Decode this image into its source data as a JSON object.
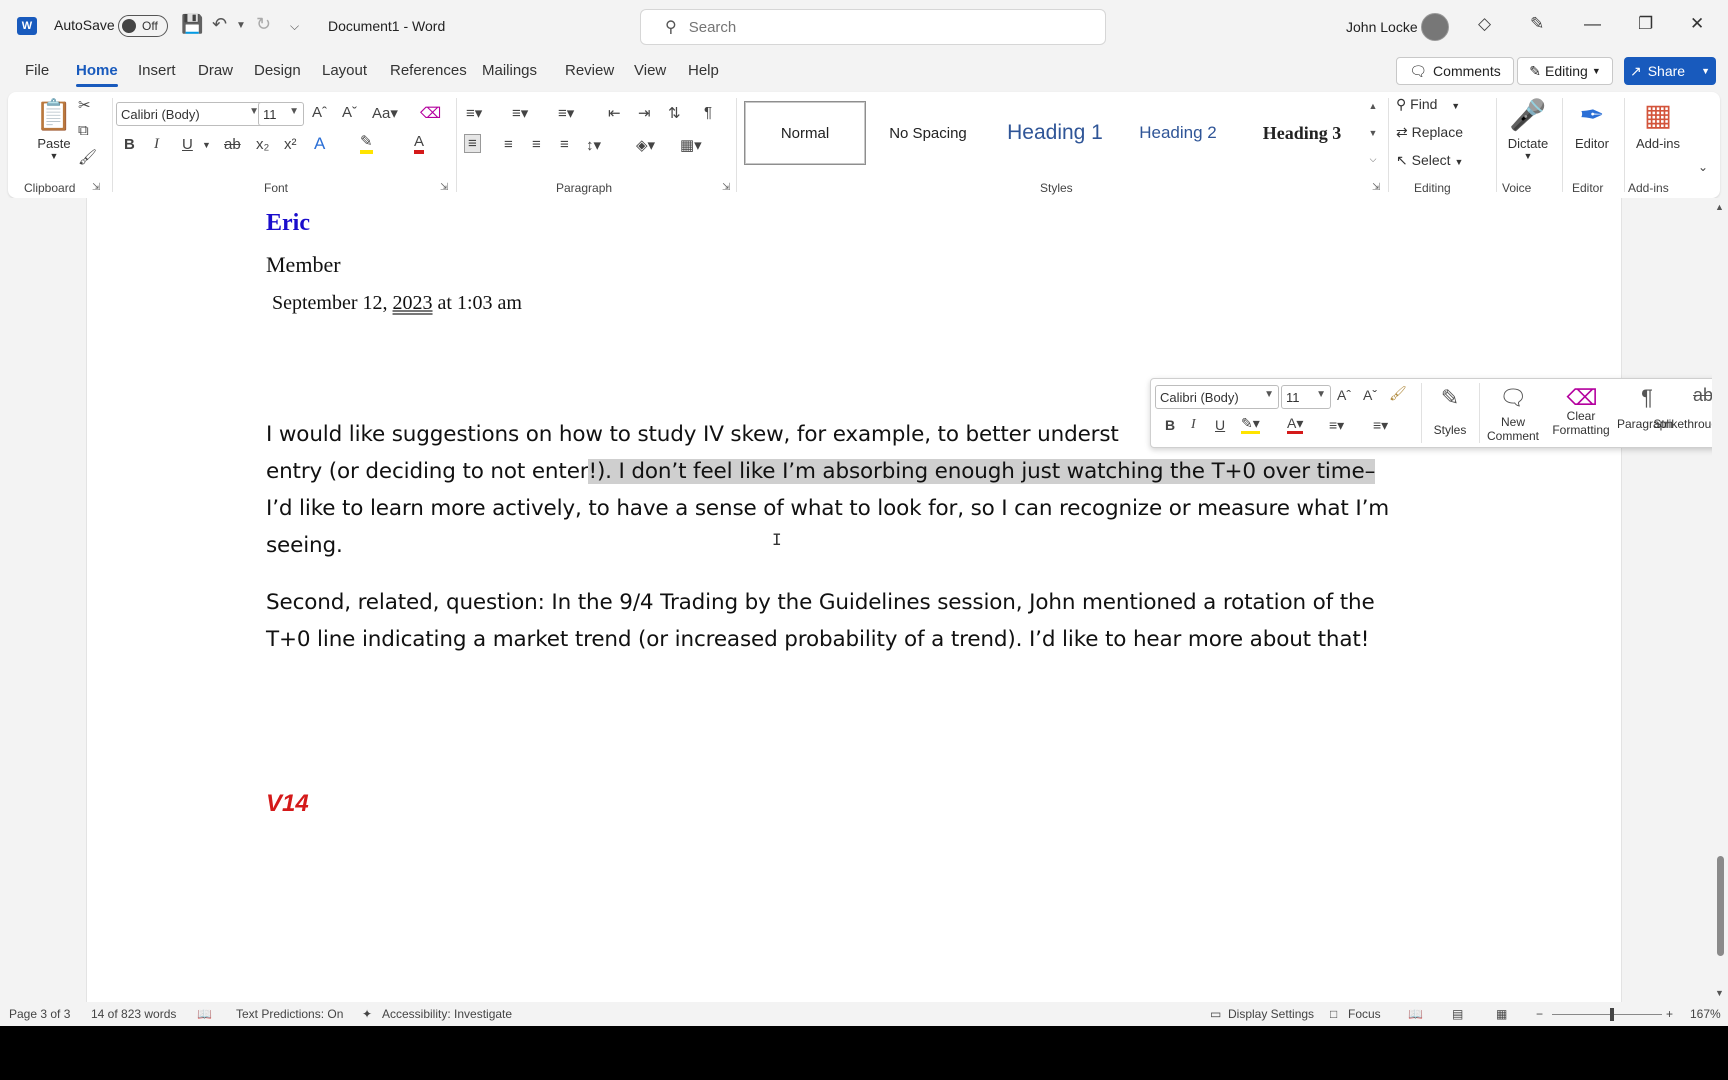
{
  "titlebar": {
    "autosave_label": "AutoSave",
    "autosave_state": "Off",
    "doc_title": "Document1  -  Word",
    "search_placeholder": "Search",
    "user_name": "John Locke"
  },
  "tabs": [
    "File",
    "Home",
    "Insert",
    "Draw",
    "Design",
    "Layout",
    "References",
    "Mailings",
    "Review",
    "View",
    "Help"
  ],
  "actions": {
    "comments": "Comments",
    "editing": "Editing",
    "share": "Share"
  },
  "ribbon": {
    "clipboard": {
      "paste": "Paste",
      "label": "Clipboard"
    },
    "font": {
      "name": "Calibri (Body)",
      "size": "11",
      "label": "Font"
    },
    "paragraph": {
      "label": "Paragraph"
    },
    "styles": {
      "label": "Styles",
      "items": [
        "Normal",
        "No Spacing",
        "Heading 1",
        "Heading 2",
        "Heading 3"
      ]
    },
    "editing": {
      "find": "Find",
      "replace": "Replace",
      "select": "Select",
      "label": "Editing"
    },
    "voice": {
      "dictate": "Dictate",
      "label": "Voice"
    },
    "editor": {
      "editor": "Editor",
      "label": "Editor"
    },
    "addins": {
      "addins": "Add-ins",
      "label": "Add-ins"
    }
  },
  "document": {
    "name": "Eric",
    "role": "Member",
    "date_before": "September 12, ",
    "date_year": "2023",
    "date_after": " at 1:03 am",
    "p1_line1": "I would like suggestions on how to study IV skew, for example, to better underst",
    "p1_line2_plain": "entry (or deciding to not enter",
    "p1_line2_highlight": "!). I don’t feel like I’m absorbing enough just watching the T+0 over time–",
    "p1_line3": "I’d like to learn more actively, to have a sense of what to look for, so I can recognize or measure what I’m",
    "p1_line4": "seeing.",
    "p2_line1": "Second, related, question: In the 9/4 Trading by the Guidelines session, John mentioned a rotation of the",
    "p2_line2": "T+0 line indicating a market trend (or increased probability of a trend). I’d like to hear more about that!",
    "v14": "V14"
  },
  "mini_toolbar": {
    "font": "Calibri (Body)",
    "size": "11",
    "styles": "Styles",
    "new_comment_1": "New",
    "new_comment_2": "Comment",
    "clear_1": "Clear",
    "clear_2": "Formatting",
    "paragraph": "Paragraph",
    "strikethrough": "Strikethrough"
  },
  "status": {
    "page": "Page 3 of 3",
    "words": "14 of 823 words",
    "predictions": "Text Predictions: On",
    "accessibility": "Accessibility: Investigate",
    "display_settings": "Display Settings",
    "focus": "Focus",
    "zoom": "167%"
  },
  "colors": {
    "accent": "#185abd",
    "name_blue": "#1a0dcc",
    "v14_red": "#d41a1a",
    "highlight": "#cfcfcf"
  }
}
